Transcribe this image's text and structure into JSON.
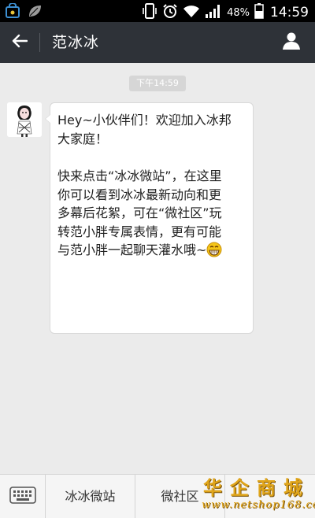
{
  "statusbar": {
    "battery_percent": "48%",
    "time": "14:59",
    "icons": [
      "shopping-bag-icon",
      "leaf-icon",
      "phone-vibrate-icon",
      "alarm-icon",
      "wifi-icon",
      "signal-icon",
      "battery-icon"
    ]
  },
  "header": {
    "title": "范冰冰",
    "back_icon": "back-arrow-icon",
    "profile_icon": "person-icon",
    "bg_color": "#2e3238"
  },
  "chat": {
    "timestamp": "下午14:59",
    "message": {
      "sender_avatar": "avatar",
      "lines_p1": [
        "Hey~小伙伴们！欢迎加入冰邦",
        "大家庭！"
      ],
      "lines_p2": [
        "快来点击“冰冰微站”，在这里",
        "你可以看到冰冰最新动向和更",
        "多幕后花絮，可在“微社区”玩",
        "转范小胖专属表情，更有可能",
        "与范小胖一起聊天灌水哦~"
      ],
      "emoji": "grinning-face-icon"
    }
  },
  "bottom_menu": {
    "keyboard_icon": "keyboard-icon",
    "items": [
      "冰冰微站",
      "微社区",
      ""
    ]
  },
  "watermark": {
    "title": "华企商城",
    "url": "www.netshop168.com"
  }
}
